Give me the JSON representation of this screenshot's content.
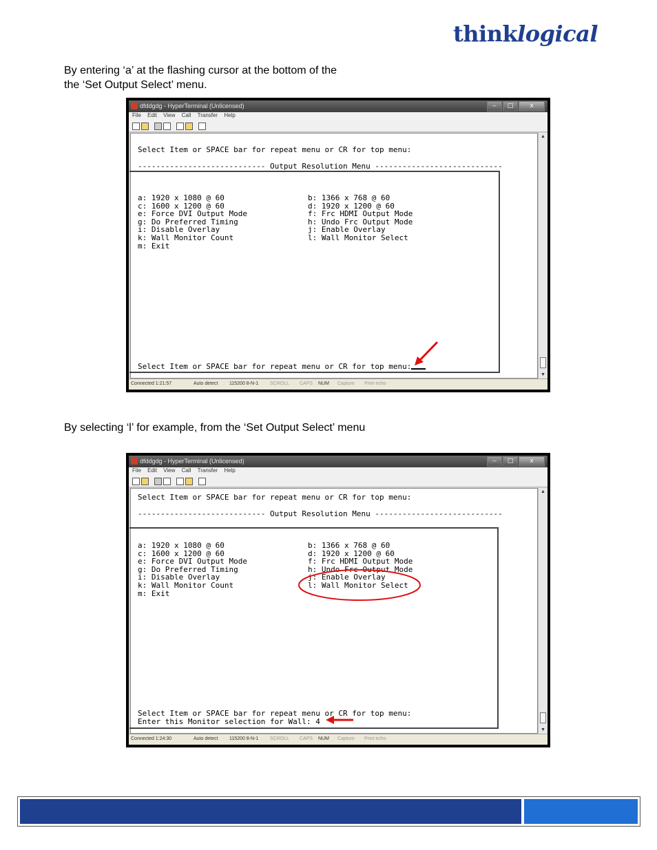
{
  "logo": {
    "part1": "think",
    "part2": "logical"
  },
  "paragraphs": {
    "p1_line1": "By entering ‘a’ at the flashing cursor at the bottom of the",
    "p1_line2": "the ‘Set Output Select’ menu.",
    "p2": "By selecting ‘l’ for example, from the ‘Set Output Select’ menu"
  },
  "window": {
    "title": "dfddgdg - HyperTerminal (Unlicensed)",
    "menu": [
      "File",
      "Edit",
      "View",
      "Call",
      "Transfer",
      "Help"
    ],
    "btn_min": "‒",
    "btn_max": "□",
    "btn_close": "x"
  },
  "terminal": {
    "prompt": "Select Item or SPACE bar for repeat menu or CR for top menu:",
    "header": "---------------------------- Output Resolution Menu ----------------------------",
    "menu_left": "a: 1920 x 1080 @ 60\nc: 1600 x 1200 @ 60\ne: Force DVI Output Mode\ng: Do Preferred Timing\ni: Disable Overlay\nk: Wall Monitor Count\nm: Exit",
    "menu_right": "b: 1366 x 768 @ 60\nd: 1920 x 1200 @ 60\nf: Frc HDMI Output Mode\nh: Undo Frc Output Mode\nj: Enable Overlay\nl: Wall Monitor Select",
    "wall_prompt": "Enter this Monitor selection for Wall: 4"
  },
  "status1": {
    "connected": "Connected 1:21:57",
    "detect": "Auto detect",
    "baud": "115200 8-N-1",
    "scroll": "SCROLL",
    "caps": "CAPS",
    "num": "NUM",
    "capture": "Capture",
    "echo": "Print echo"
  },
  "status2": {
    "connected": "Connected 1:24:30",
    "detect": "Auto detect",
    "baud": "115200 8-N-1",
    "scroll": "SCROLL",
    "caps": "CAPS",
    "num": "NUM",
    "capture": "Capture",
    "echo": "Print echo"
  },
  "colors": {
    "brand_blue": "#1f3f8f",
    "footer_light": "#1f6fd4",
    "annotation_red": "#e01010"
  }
}
